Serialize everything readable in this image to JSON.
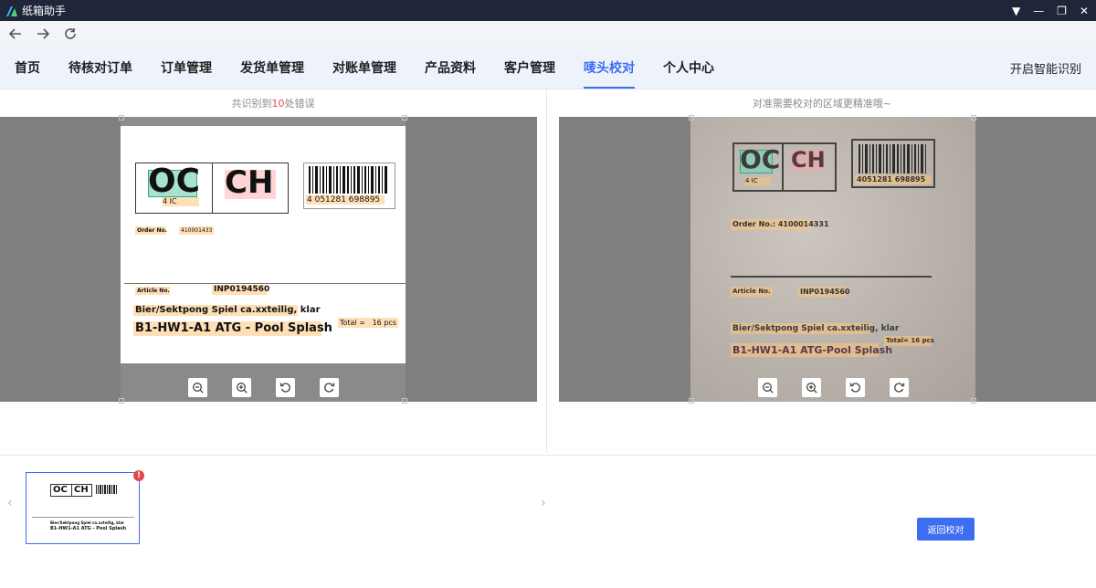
{
  "app": {
    "title": "纸箱助手"
  },
  "nav": {
    "back_icon": "arrow-left-icon",
    "forward_icon": "arrow-right-icon",
    "refresh_icon": "refresh-icon"
  },
  "menu": {
    "items": [
      "首页",
      "待核对订单",
      "订单管理",
      "发货单管理",
      "对账单管理",
      "产品资料",
      "客户管理",
      "唛头校对",
      "个人中心"
    ],
    "active_index": 7,
    "smart_recognize": "开启智能识别"
  },
  "left_panel": {
    "caption_prefix": "共识别到",
    "caption_count": "10",
    "caption_suffix": "处错误"
  },
  "right_panel": {
    "caption": "对准需要校对的区域更精准哦~"
  },
  "label": {
    "code1": "OC",
    "code1_sub": "4 IC",
    "code2": "CH",
    "barcode_number": "4 051281 698895",
    "order_label": "Order No.",
    "order_number": "410001433",
    "article_label": "Article No.",
    "article_number": "INP0194560",
    "desc_line1": "Bier/Sektpong Spiel ca.xxteilig, klar",
    "desc_line2": "B1-HW1-A1 ATG - Pool Splash",
    "total_label": "Total =",
    "total_value": "16",
    "total_unit": "pcs"
  },
  "photo_label": {
    "code1": "OC",
    "code1_sub": "4 IC",
    "code2": "CH",
    "barcode_number": "4051281 698895",
    "order_text": "Order No.: 4100014331",
    "article_label": "Article No.",
    "article_number": "INP0194560",
    "desc_line1": "Bier/Sektpong Spiel ca.xxteilig, klar",
    "desc_line2": "B1-HW1-A1 ATG-Pool Splash",
    "total_text": "Total= 16 pcs"
  },
  "thumbnail": {
    "code1": "OC",
    "code2": "CH",
    "line1": "Bier/Sektpong Spiel ca.xxteilig, klar",
    "line2": "B1-HW1-A1 ATG - Pool Splash",
    "badge": "!"
  },
  "return_button": "返回校对",
  "colors": {
    "accent": "#3d6ef2",
    "error": "#e5484d",
    "titlebar": "#20263a",
    "menubar": "#eef2fb"
  }
}
